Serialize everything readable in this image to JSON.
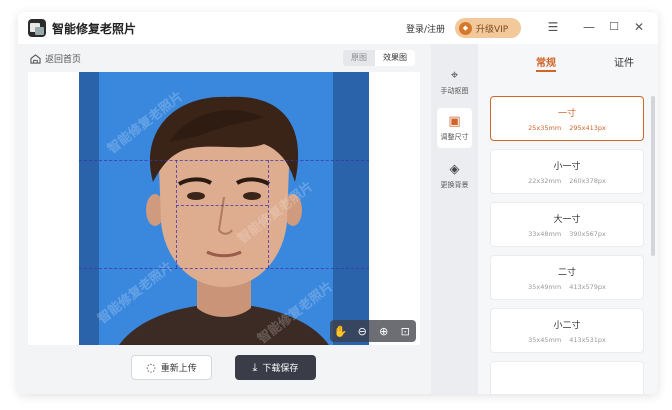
{
  "app": {
    "title": "智能修复老照片"
  },
  "titlebar": {
    "login_label": "登录/注册",
    "vip_label": "升级VIP",
    "vip_icon": "diamond-icon",
    "controls": [
      "menu-icon",
      "minimize-icon",
      "maximize-icon",
      "close-icon"
    ]
  },
  "toolbar": {
    "back_label": "返回首页",
    "view_toggle": [
      {
        "label": "原图",
        "active": false
      },
      {
        "label": "效果图",
        "active": true
      }
    ]
  },
  "photo": {
    "background_color": "#3a88de",
    "band_color": "#2a63a9",
    "watermark_text": "智能修复老照片"
  },
  "zoom_controls": [
    "hand-icon",
    "zoom-out-icon",
    "zoom-in-icon",
    "fit-icon"
  ],
  "actions": {
    "reupload_label": "重新上传",
    "download_label": "下载保存"
  },
  "tools": [
    {
      "label": "手动抠图",
      "icon": "cursor-icon",
      "active": false
    },
    {
      "label": "调整尺寸",
      "icon": "resize-icon",
      "active": true
    },
    {
      "label": "更换背景",
      "icon": "paint-bucket-icon",
      "active": false
    }
  ],
  "size_tabs": [
    {
      "label": "常规",
      "active": true
    },
    {
      "label": "证件",
      "active": false
    }
  ],
  "sizes": [
    {
      "name": "一寸",
      "mm": "25x35mm",
      "px": "295x413px",
      "active": true
    },
    {
      "name": "小一寸",
      "mm": "22x32mm",
      "px": "260x378px",
      "active": false
    },
    {
      "name": "大一寸",
      "mm": "33x48mm",
      "px": "390x567px",
      "active": false
    },
    {
      "name": "二寸",
      "mm": "35x49mm",
      "px": "413x579px",
      "active": false
    },
    {
      "name": "小二寸",
      "mm": "35x45mm",
      "px": "413x531px",
      "active": false
    }
  ],
  "colors": {
    "accent": "#d0652a",
    "dark_button": "#3a3d48",
    "vip_bg": "#f3c89a"
  }
}
